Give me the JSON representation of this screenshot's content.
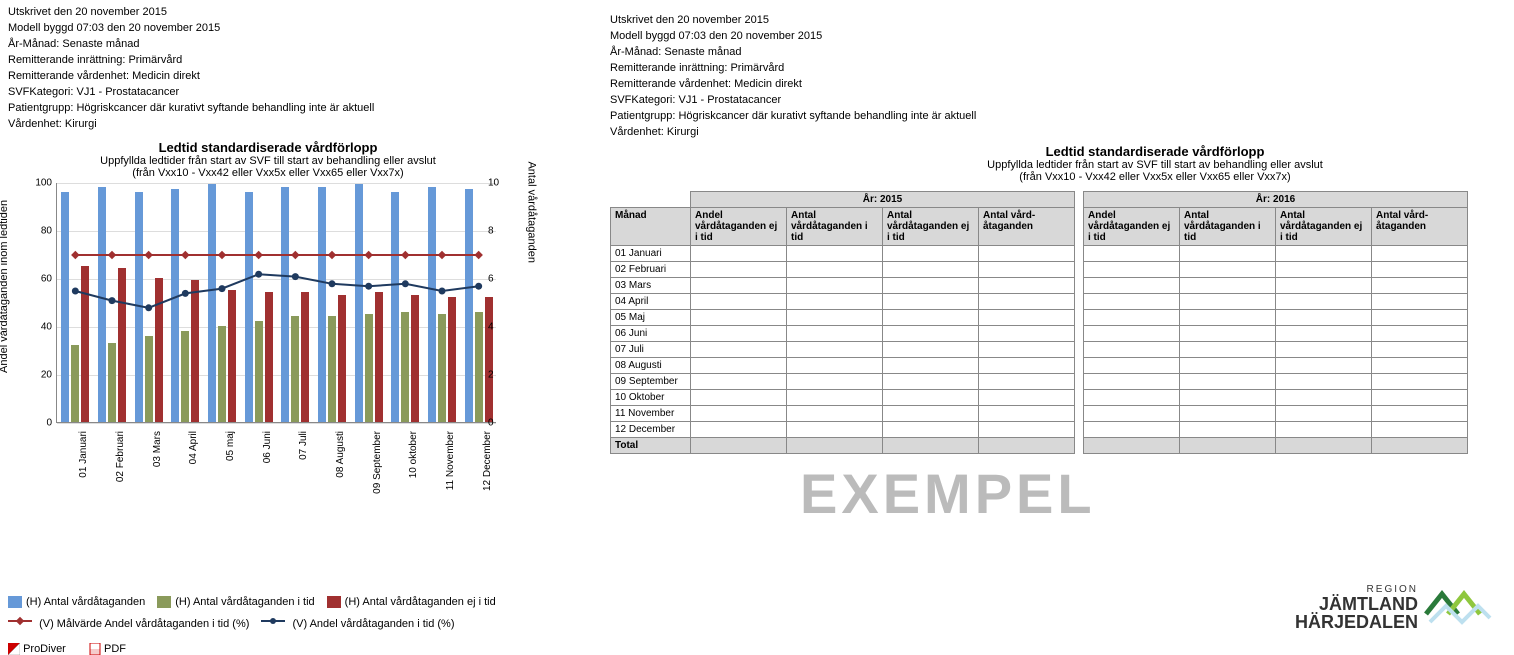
{
  "left": {
    "meta": [
      "Utskrivet den 20 november 2015",
      "Modell byggd 07:03 den 20 november 2015",
      "År-Månad: Senaste månad",
      "Remitterande inrättning: Primärvård",
      "Remitterande vårdenhet: Medicin direkt",
      "SVFKategori: VJ1 - Prostatacancer",
      "Patientgrupp: Högriskcancer där kurativt syftande behandling inte är aktuell",
      "Vårdenhet: Kirurgi"
    ],
    "title": "Ledtid standardiserade vårdförlopp",
    "sub1": "Uppfyllda ledtider från start av SVF till start av behandling eller avslut",
    "sub2": "(från Vxx10 - Vxx42 eller Vxx5x eller Vxx65 eller Vxx7x)",
    "y_left_label": "Andel vårdåtaganden inom ledtiden",
    "y_right_label": "Antal vårdåtaganden",
    "legend": {
      "blue": "(H) Antal vårdåtaganden",
      "olive": "(H) Antal vårdåtaganden i tid",
      "red": "(H) Antal vårdåtaganden ej i tid",
      "target": "(V) Målvärde Andel vårdåtaganden i tid (%)",
      "actual": "(V) Andel vårdåtaganden i tid (%)"
    },
    "footer": {
      "prodiver": "ProDiver",
      "pdf": "PDF"
    }
  },
  "right": {
    "meta": [
      "Utskrivet den 20 november 2015",
      "Modell byggd 07:03 den 20 november 2015",
      "År-Månad: Senaste månad",
      "Remitterande inrättning: Primärvård",
      "Remitterande vårdenhet: Medicin direkt",
      "SVFKategori: VJ1 - Prostatacancer",
      "Patientgrupp: Högriskcancer där kurativt syftande behandling inte är aktuell",
      "Vårdenhet: Kirurgi"
    ],
    "title": "Ledtid standardiserade vårdförlopp",
    "sub1": "Uppfyllda ledtider från start av SVF till start av behandling eller avslut",
    "sub2": "(från Vxx10 - Vxx42 eller Vxx5x eller Vxx65 eller Vxx7x)",
    "year1": "År:  2015",
    "year2": "År:  2016",
    "columns": [
      "Månad",
      "Andel vårdåtaganden ej i tid",
      "Antal vårdåtaganden i tid",
      "Antal vårdåtaganden ej i tid",
      "Antal vård-åtaganden"
    ],
    "months": [
      "01 Januari",
      "02 Februari",
      "03 Mars",
      "04 April",
      "05 Maj",
      "06 Juni",
      "07 Juli",
      "08 Augusti",
      "09 September",
      "10 Oktober",
      "11 November",
      "12 December"
    ],
    "total": "Total",
    "watermark": "EXEMPEL"
  },
  "logo": {
    "region": "REGION",
    "line1": "JÄMTLAND",
    "line2": "HÄRJEDALEN"
  },
  "chart_data": {
    "type": "bar",
    "categories": [
      "01 Januari",
      "02 Februari",
      "03 Mars",
      "04 April",
      "05 maj",
      "06 Juni",
      "07 Juli",
      "08 Augusti",
      "09 September",
      "10 oktober",
      "11 November",
      "12 December"
    ],
    "y_left": {
      "min": 0,
      "max": 100,
      "ticks": [
        0,
        20,
        40,
        60,
        80,
        100
      ]
    },
    "y_right": {
      "min": 0,
      "max": 10,
      "ticks": [
        0,
        2,
        4,
        6,
        8,
        10
      ]
    },
    "series_bars": [
      {
        "name": "(H) Antal vårdåtaganden",
        "color": "#6699d8",
        "values": [
          96,
          98,
          96,
          97,
          99,
          96,
          98,
          98,
          99,
          96,
          98,
          97
        ]
      },
      {
        "name": "(H) Antal vårdåtaganden i tid",
        "color": "#8a9a5b",
        "values": [
          32,
          33,
          36,
          38,
          40,
          42,
          44,
          44,
          45,
          46,
          45,
          46
        ]
      },
      {
        "name": "(H) Antal vårdåtaganden ej i tid",
        "color": "#a03030",
        "values": [
          65,
          64,
          60,
          59,
          55,
          54,
          54,
          53,
          54,
          53,
          52,
          52
        ]
      }
    ],
    "series_lines": [
      {
        "name": "(V) Målvärde Andel vårdåtaganden i tid (%)",
        "color": "#a03030",
        "marker": "diamond",
        "values": [
          70,
          70,
          70,
          70,
          70,
          70,
          70,
          70,
          70,
          70,
          70,
          70
        ]
      },
      {
        "name": "(V) Andel vårdåtaganden i tid (%)",
        "color": "#1f3a5f",
        "marker": "circle",
        "values": [
          55,
          51,
          48,
          54,
          56,
          62,
          61,
          58,
          57,
          58,
          55,
          57
        ]
      }
    ]
  }
}
